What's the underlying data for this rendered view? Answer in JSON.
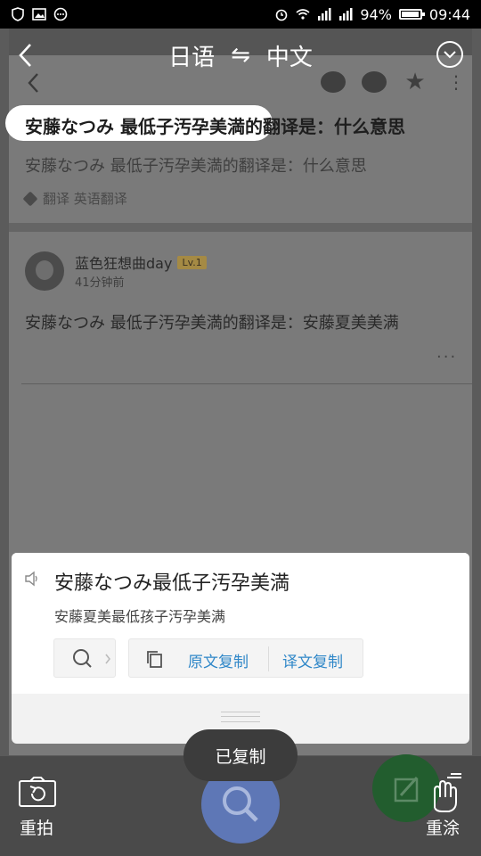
{
  "status_bar": {
    "battery": "94%",
    "time": "09:44"
  },
  "header": {
    "source_lang": "日语",
    "swap_symbol": "⇋",
    "target_lang": "中文"
  },
  "background_page": {
    "question_title": "安藤なつみ 最低子汚孕美満的翻译是：什么意思",
    "question_subtitle": "安藤なつみ 最低子汚孕美満的翻译是：什么意思",
    "tags": "翻译  英语翻译",
    "answerer": {
      "name": "蓝色狂想曲day",
      "level": "Lv.1",
      "time": "41分钟前"
    },
    "answer": "安藤なつみ 最低子汚孕美満的翻译是：安藤夏美美满",
    "more": "···"
  },
  "card": {
    "source_text": "安藤なつみ最低子汚孕美満",
    "translation": "安藤夏美最低孩子汚孕美满",
    "copy_original": "原文复制",
    "copy_translation": "译文复制"
  },
  "toast": "已复制",
  "bottom": {
    "retake_label": "重拍",
    "repaint_label": "重涂"
  },
  "colors": {
    "link_blue": "#2f87c8",
    "fab_green": "#225d2e",
    "search_blue": "#5e77b6"
  }
}
